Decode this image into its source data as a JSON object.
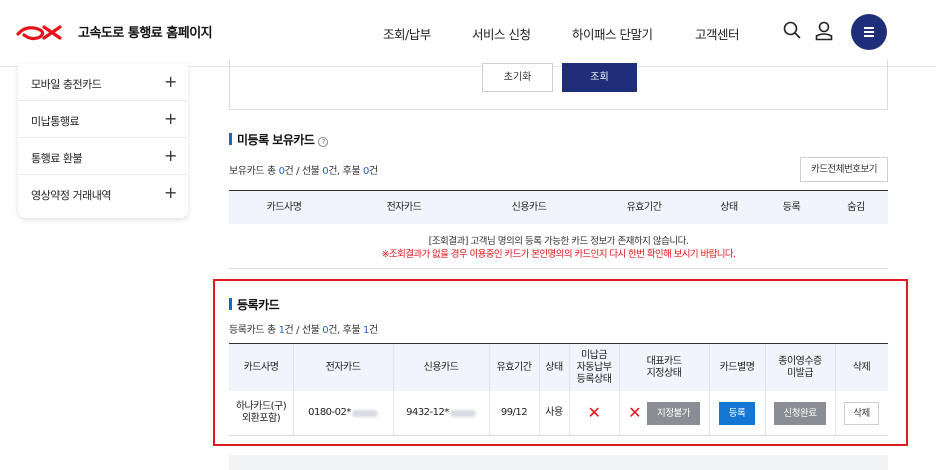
{
  "header": {
    "logo_text": "고속도로 통행료 홈페이지",
    "nav": [
      "조회/납부",
      "서비스 신청",
      "하이패스 단말기",
      "고객센터"
    ],
    "icons": [
      "search-icon",
      "user-icon",
      "menu-icon"
    ],
    "brand_color": "#e8131b",
    "accent_color": "#1f2e78"
  },
  "sidebar": {
    "items": [
      {
        "label": "모바일 충전카드",
        "toggle": "+"
      },
      {
        "label": "미납통행료",
        "toggle": "+"
      },
      {
        "label": "통행료 환불",
        "toggle": "+"
      },
      {
        "label": "영상약정 거래내역",
        "toggle": "+"
      }
    ]
  },
  "search": {
    "reset_label": "초기화",
    "search_label": "조회"
  },
  "unregistered": {
    "title": "미등록 보유카드",
    "summary": {
      "prefix": "보유카드 총 ",
      "total": "0",
      "mid1": "건 / 선불 ",
      "prepaid": "0",
      "mid2": "건, 후불 ",
      "postpaid": "0",
      "suffix": "건"
    },
    "view_all_label": "카드전체번호보기",
    "columns": [
      "카드사명",
      "전자카드",
      "신용카드",
      "유효기간",
      "상태",
      "등록",
      "숨김"
    ],
    "empty_message": "[조회결과] 고객님 명의의 등록 가능한 카드 정보가 존재하지 않습니다.",
    "empty_note": "※조회결과가 없을 경우 이용중인 카드가 본인명의의 카드인지 다시 한번 확인해 보시기 바랍니다."
  },
  "registered": {
    "title": "등록카드",
    "summary": {
      "prefix": "등록카드 총 ",
      "total": "1",
      "mid1": "건 / 선불 ",
      "prepaid": "0",
      "mid2": "건, 후불 ",
      "postpaid": "1",
      "suffix": "건"
    },
    "columns": [
      "카드사명",
      "전자카드",
      "신용카드",
      "유효기간",
      "상태",
      "미납금\n자동납부\n등록상태",
      "대표카드\n지정상태",
      "카드별명",
      "종이영수증\n미발급",
      "삭제"
    ],
    "rows": [
      {
        "card_company": "하나카드(구)\n외환포함)",
        "electronic_card": "0180-02*",
        "credit_card": "9432-12*",
        "expiry": "99/12",
        "status": "사용",
        "autopay_mark": "✕",
        "main_card_mark": "✕",
        "main_card_button": "지정불가",
        "nickname_button": "등록",
        "receipt_button": "신청완료",
        "delete_button": "삭제"
      }
    ]
  }
}
